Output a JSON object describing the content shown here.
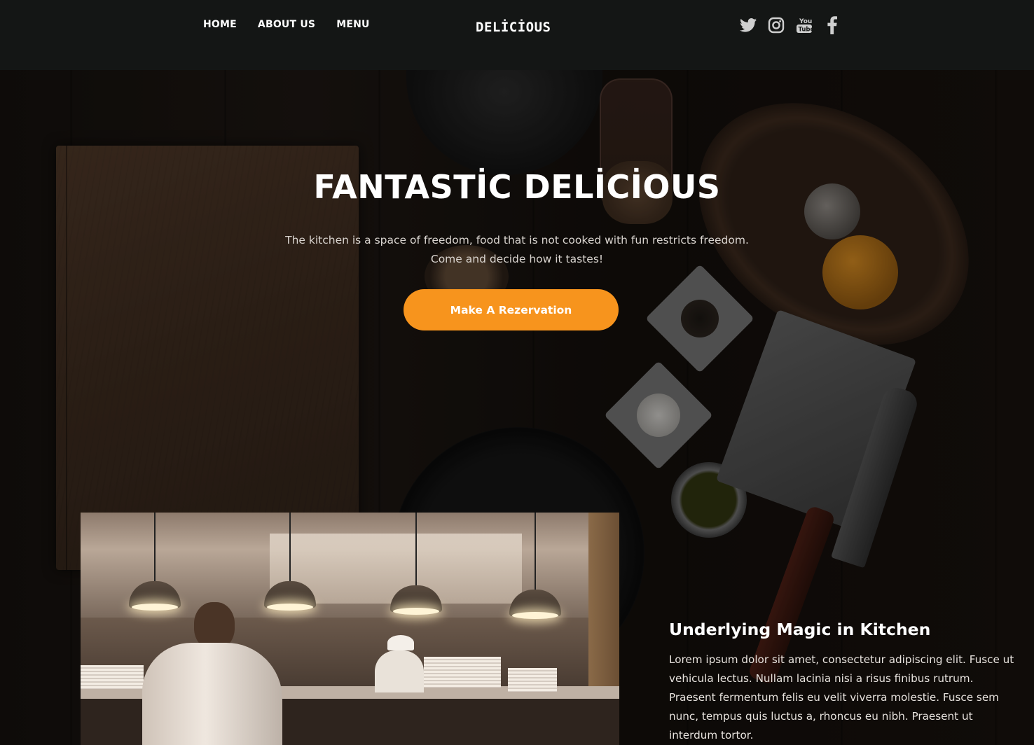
{
  "nav": {
    "items": [
      {
        "label": "HOME"
      },
      {
        "label": "ABOUT US"
      },
      {
        "label": "MENU"
      }
    ],
    "logo": "DELİCİOUS"
  },
  "social": {
    "icons": [
      "twitter-icon",
      "instagram-icon",
      "youtube-icon",
      "facebook-icon"
    ],
    "youtube_text_top": "You",
    "youtube_text_bottom": "Tube"
  },
  "hero": {
    "title": "FANTASTİC DELİCİOUS",
    "subtitle_line1": "The kitchen is a space of freedom, food that is not cooked with fun restricts freedom.",
    "subtitle_line2": "Come and decide how it tastes!",
    "cta_label": "Make A Rezervation"
  },
  "section": {
    "title": "Underlying Magic in Kitchen",
    "body": "Lorem ipsum dolor sit amet, consectetur adipiscing elit. Fusce ut vehicula lectus. Nullam lacinia nisi a risus finibus rutrum. Praesent fermentum felis eu velit viverra molestie. Fusce sem nunc, tempus quis luctus a, rhoncus eu nibh. Praesent ut interdum tortor."
  },
  "colors": {
    "header_bg": "#141615",
    "accent": "#f7941d",
    "text": "#ffffff",
    "icon": "#cfcfcf"
  }
}
